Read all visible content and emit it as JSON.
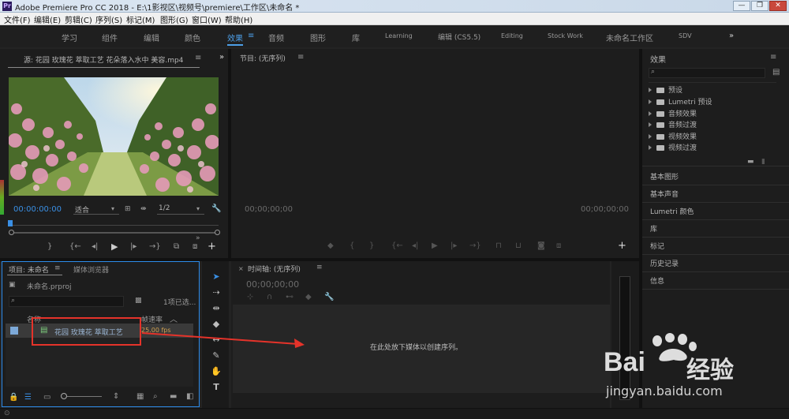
{
  "window": {
    "icon": "Pr",
    "title": "Adobe Premiere Pro CC 2018 - E:\\1影视区\\视频号\\premiere\\工作区\\未命名 *"
  },
  "menu": [
    "文件(F)",
    "编辑(E)",
    "剪辑(C)",
    "序列(S)",
    "标记(M)",
    "图形(G)",
    "窗口(W)",
    "帮助(H)"
  ],
  "workspaces": {
    "items": [
      "学习",
      "组件",
      "编辑",
      "颜色",
      "效果",
      "音频",
      "图形",
      "库",
      "Learning",
      "编辑 (CS5.5)",
      "Editing",
      "Stock Work",
      "未命名工作区",
      "SDV"
    ],
    "active": "效果",
    "more": "»"
  },
  "source": {
    "tab": "源: 花园 玫瑰花 萃取工艺 花朵落入水中 美容.mp4",
    "timecode": "00:00:00:00",
    "zoom": "适合",
    "resolution": "1/2"
  },
  "program": {
    "tab": "节目: (无序列)",
    "timecode_left": "00;00;00;00",
    "timecode_right": "00;00;00;00"
  },
  "effects": {
    "title": "效果",
    "items": [
      "预设",
      "Lumetri 预设",
      "音频效果",
      "音频过渡",
      "视频效果",
      "视频过渡"
    ]
  },
  "side_panels": [
    "基本图形",
    "基本声音",
    "Lumetri 颜色",
    "库",
    "标记",
    "历史记录",
    "信息"
  ],
  "project": {
    "tab": "项目: 未命名",
    "tab2": "媒体浏览器",
    "file": "未命名.prproj",
    "selection": "1项已选...",
    "col_name": "名称",
    "col_rate": "帧速率",
    "item_name": "花园 玫瑰花 萃取工艺",
    "item_rate": "25.00 fps"
  },
  "timeline": {
    "tab": "时间轴: (无序列)",
    "timecode": "00;00;00;00",
    "drop_hint": "在此处放下媒体以创建序列。"
  },
  "watermark": {
    "brand": "Bai",
    "cn": "经验",
    "url": "jingyan.baidu.com"
  },
  "colors": {
    "accent": "#3a8fe4",
    "annotation": "#e5332a"
  }
}
